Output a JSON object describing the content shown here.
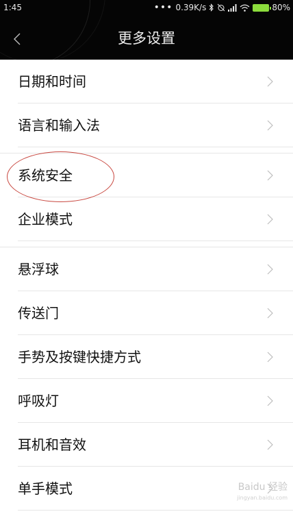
{
  "status_bar": {
    "time": "1:45",
    "net_speed": "0.39K/s",
    "battery": "80%"
  },
  "header": {
    "title": "更多设置"
  },
  "groups": [
    {
      "items": [
        "日期和时间",
        "语言和输入法"
      ]
    },
    {
      "items": [
        "系统安全",
        "企业模式"
      ]
    },
    {
      "items": [
        "悬浮球",
        "传送门",
        "手势及按键快捷方式",
        "呼吸灯",
        "耳机和音效",
        "单手模式"
      ]
    }
  ],
  "watermark": {
    "brand": "Baidu 经验",
    "url": "jingyan.baidu.com"
  },
  "colors": {
    "header_bg": "#050505",
    "annotation": "#c8463e",
    "battery": "#8bdc3c"
  }
}
